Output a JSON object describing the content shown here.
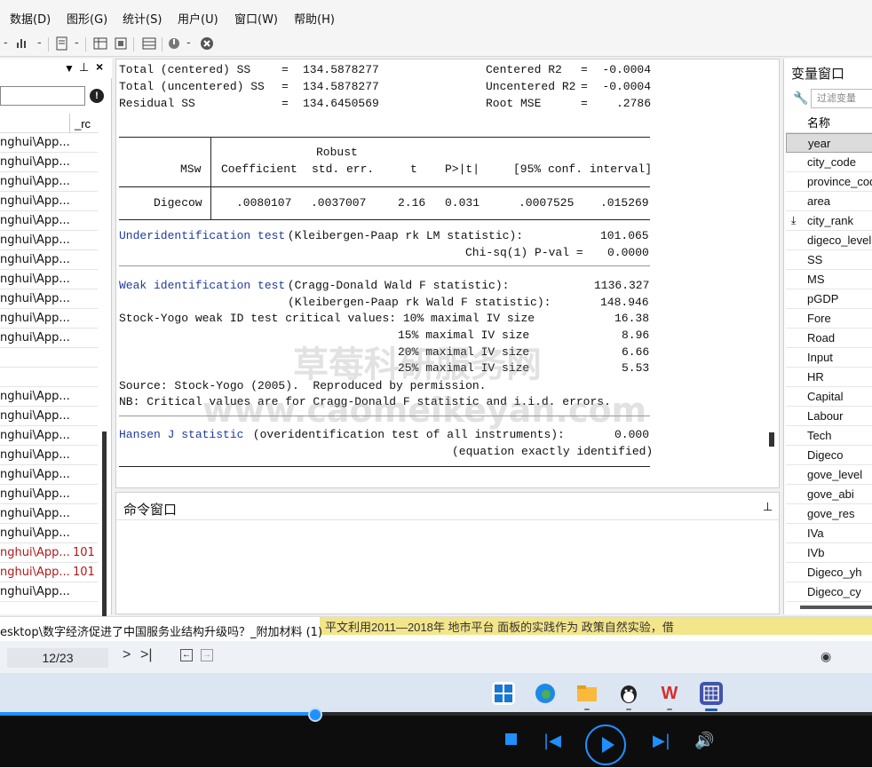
{
  "menu": [
    "数据(D)",
    "图形(G)",
    "统计(S)",
    "用户(U)",
    "窗口(W)",
    "帮助(H)"
  ],
  "left_panel": {
    "col_header": "_rc",
    "rows": [
      {
        "text": "nghui\\App...",
        "rc": ""
      },
      {
        "text": "nghui\\App...",
        "rc": ""
      },
      {
        "text": "nghui\\App...",
        "rc": ""
      },
      {
        "text": "nghui\\App...",
        "rc": ""
      },
      {
        "text": "nghui\\App...",
        "rc": ""
      },
      {
        "text": "nghui\\App...",
        "rc": ""
      },
      {
        "text": "nghui\\App...",
        "rc": ""
      },
      {
        "text": "nghui\\App...",
        "rc": ""
      },
      {
        "text": "nghui\\App...",
        "rc": ""
      },
      {
        "text": "nghui\\App...",
        "rc": ""
      },
      {
        "text": "nghui\\App...",
        "rc": ""
      },
      {
        "text": "",
        "rc": ""
      },
      {
        "text": "",
        "rc": ""
      },
      {
        "text": "nghui\\App...",
        "rc": ""
      },
      {
        "text": "nghui\\App...",
        "rc": ""
      },
      {
        "text": "nghui\\App...",
        "rc": ""
      },
      {
        "text": "nghui\\App...",
        "rc": ""
      },
      {
        "text": "nghui\\App...",
        "rc": ""
      },
      {
        "text": "nghui\\App...",
        "rc": ""
      },
      {
        "text": "nghui\\App...",
        "rc": ""
      },
      {
        "text": "nghui\\App...",
        "rc": ""
      },
      {
        "text": "nghui\\App...",
        "rc": "101",
        "error": true
      },
      {
        "text": "nghui\\App...",
        "rc": "101",
        "error": true
      },
      {
        "text": "nghui\\App...",
        "rc": ""
      }
    ]
  },
  "results": {
    "stats": [
      {
        "label": "Total (centered) SS",
        "eq": "=",
        "value": "134.5878277",
        "label2": "Centered R2",
        "eq2": "=",
        "value2": "-0.0004"
      },
      {
        "label": "Total (uncentered) SS",
        "eq": "=",
        "value": "134.5878277",
        "label2": "Uncentered R2",
        "eq2": "=",
        "value2": "-0.0004"
      },
      {
        "label": "Residual SS",
        "eq": "=",
        "value": "134.6450569",
        "label2": "Root MSE",
        "eq2": "=",
        "value2": ".2786"
      }
    ],
    "table": {
      "robust": "Robust",
      "depvar": "MSw",
      "headers": [
        "Coefficient",
        "std. err.",
        "t",
        "P>|t|",
        "[95% conf. interval]"
      ],
      "row": {
        "var": "Digecow",
        "coef": ".0080107",
        "se": ".0037007",
        "t": "2.16",
        "p": "0.031",
        "lo": ".0007525",
        "hi": ".015269"
      }
    },
    "underid": {
      "title": "Underidentification test",
      "desc": " (Kleibergen-Paap rk LM statistic):",
      "value": "101.065",
      "pval_label": "Chi-sq(1) P-val =",
      "pval": "0.0000"
    },
    "weakid": {
      "title": "Weak identification test",
      "desc": " (Cragg-Donald Wald F statistic):",
      "value": "1136.327",
      "kp_label": "(Kleibergen-Paap rk Wald F statistic):",
      "kp_value": "148.946",
      "sy_label": "Stock-Yogo weak ID test critical values: 10% maximal IV size",
      "sy_value": "16.38",
      "sy2_label": "15% maximal IV size",
      "sy2_value": "8.96",
      "sy3_label": "20% maximal IV size",
      "sy3_value": "6.66",
      "sy4_label": "25% maximal IV size",
      "sy4_value": "5.53",
      "source": "Source: Stock-Yogo (2005).  Reproduced by permission.",
      "nb": "NB: Critical values are for Cragg-Donald F statistic and i.i.d. errors."
    },
    "hansen": {
      "title": "Hansen J statistic",
      "desc": " (overidentification test of all instruments):",
      "value": "0.000",
      "note": "(equation exactly identified)"
    }
  },
  "command_window": {
    "title": "命令窗口",
    "pin": "⊥"
  },
  "variables_window": {
    "title": "变量窗口",
    "filter_placeholder": "过滤变量",
    "col_header": "名称",
    "vars": [
      "year",
      "city_code",
      "province_code",
      "area",
      "city_rank",
      "digeco_level",
      "SS",
      "MS",
      "pGDP",
      "Fore",
      "Road",
      "Input",
      "HR",
      "Capital",
      "Labour",
      "Tech",
      "Digeco",
      "gove_level",
      "gove_abi",
      "gove_res",
      "IVa",
      "IVb",
      "Digeco_yh",
      "Digeco_cy"
    ],
    "selected": "year"
  },
  "status": {
    "path": "esktop\\数字经济促进了中国服务业结构升级吗？_附加材料 (1)",
    "yellow_text": "平文利用2011—2018年 地市平台 面板的实践作为 政策自然实验，借"
  },
  "doc_toolbar": {
    "page": "12/23"
  },
  "player": {
    "progress": 0.362
  },
  "watermark": {
    "cn": "草莓科研服务网",
    "en": "www.caomeikeyan.com"
  },
  "colors": {
    "accent": "#1e90ff",
    "stata_blue": "#1f3aa0",
    "error_red": "#b11a1a"
  }
}
